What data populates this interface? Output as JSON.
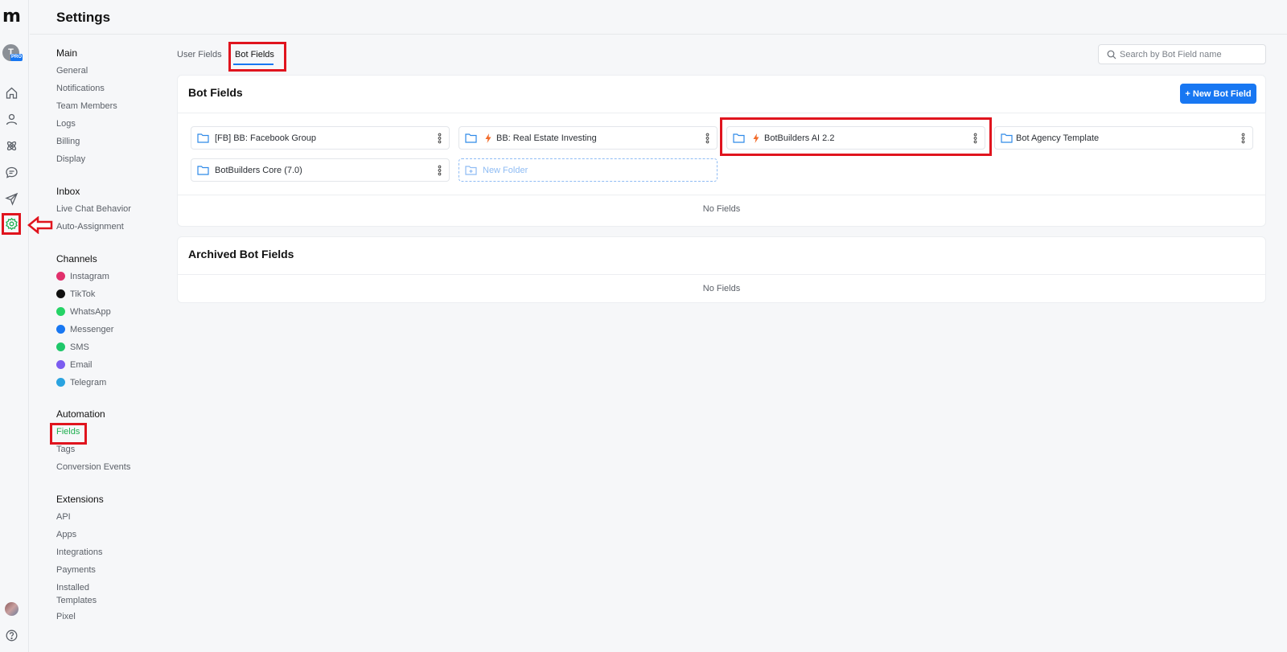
{
  "app": {
    "logo_text": "m",
    "avatar_initial": "T",
    "plan_badge": "PRO",
    "page_title": "Settings"
  },
  "rail": {
    "icons": [
      "home-icon",
      "contacts-icon",
      "automation-icon",
      "livechat-icon",
      "broadcast-icon",
      "settings-icon",
      "workspace-avatar",
      "help-icon"
    ],
    "active": "settings-icon"
  },
  "sidebar": {
    "main": {
      "title": "Main",
      "items": [
        "General",
        "Notifications",
        "Team Members",
        "Logs",
        "Billing",
        "Display"
      ]
    },
    "inbox": {
      "title": "Inbox",
      "items": [
        "Live Chat Behavior",
        "Auto-Assignment"
      ]
    },
    "channels": {
      "title": "Channels",
      "items": [
        {
          "label": "Instagram",
          "color": "#e1306c"
        },
        {
          "label": "TikTok",
          "color": "#111111"
        },
        {
          "label": "WhatsApp",
          "color": "#25d366"
        },
        {
          "label": "Messenger",
          "color": "#1877f2"
        },
        {
          "label": "SMS",
          "color": "#1ec76a"
        },
        {
          "label": "Email",
          "color": "#7b5cf0"
        },
        {
          "label": "Telegram",
          "color": "#2aa3e0"
        }
      ]
    },
    "automation": {
      "title": "Automation",
      "items": [
        "Fields",
        "Tags",
        "Conversion Events"
      ],
      "active": "Fields"
    },
    "extensions": {
      "title": "Extensions",
      "items": [
        "API",
        "Apps",
        "Integrations",
        "Payments",
        "Installed",
        "Templates",
        "Pixel"
      ]
    }
  },
  "tabs": {
    "user_fields": "User Fields",
    "bot_fields": "Bot Fields",
    "active": "Bot Fields"
  },
  "search": {
    "placeholder": "Search by Bot Field name",
    "value": ""
  },
  "bot_fields_card": {
    "title": "Bot Fields",
    "new_button": "+ New Bot Field",
    "folders": [
      {
        "label": "[FB] BB: Facebook Group",
        "bolt": false
      },
      {
        "label": "BB: Real Estate Investing",
        "bolt": true
      },
      {
        "label": "BotBuilders AI 2.2",
        "bolt": true
      },
      {
        "label": "Bot Agency Template",
        "bolt": false
      },
      {
        "label": "BotBuilders Core (7.0)",
        "bolt": false
      }
    ],
    "new_folder": "New Folder",
    "empty_text": "No Fields"
  },
  "archived_card": {
    "title": "Archived Bot Fields",
    "empty_text": "No Fields"
  },
  "colors": {
    "accent": "#1877f2",
    "active_green": "#1eaf4f",
    "annotation_red": "#e0141e",
    "bolt_orange": "#f26b2a"
  }
}
